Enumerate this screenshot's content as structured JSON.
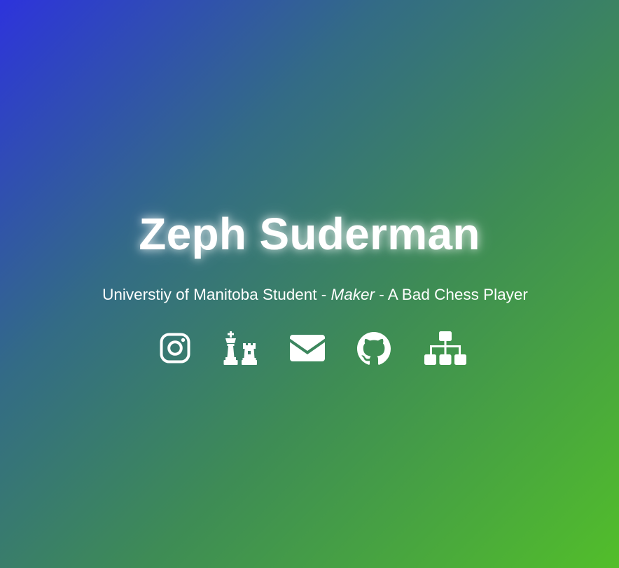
{
  "hero": {
    "name": "Zeph Suderman",
    "tagline_part1": "Universtiy of Manitoba Student - ",
    "tagline_emphasis": "Maker",
    "tagline_part2": " - A Bad Chess Player"
  },
  "socials": [
    {
      "icon": "instagram-icon"
    },
    {
      "icon": "chess-icon"
    },
    {
      "icon": "envelope-icon"
    },
    {
      "icon": "github-icon"
    },
    {
      "icon": "sitemap-icon"
    }
  ],
  "colors": {
    "gradient_start": "#2d33dc",
    "gradient_end": "#52be2a",
    "text": "#ffffff"
  }
}
